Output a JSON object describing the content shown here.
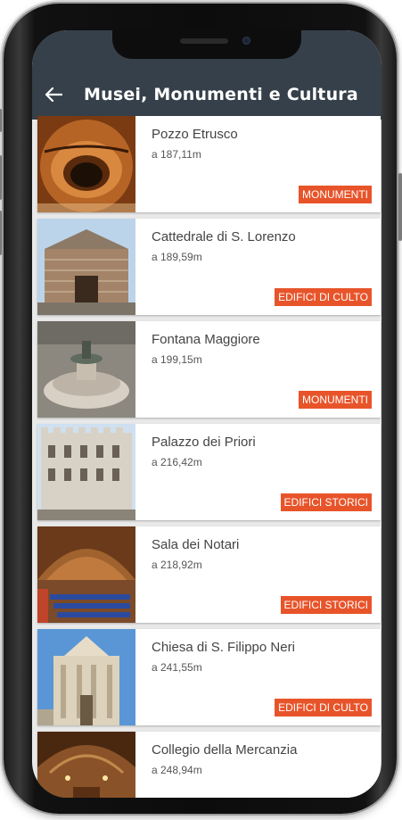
{
  "app_bar": {
    "back_icon": "arrow-left-icon",
    "title": "Musei, Monumenti e Cultura"
  },
  "places": [
    {
      "name": "Pozzo Etrusco",
      "distance": "a 187,11m",
      "category": "MONUMENTI",
      "thumb": "etruscan-well-photo"
    },
    {
      "name": "Cattedrale di S. Lorenzo",
      "distance": "a 189,59m",
      "category": "EDIFICI DI CULTO",
      "thumb": "cathedral-photo"
    },
    {
      "name": "Fontana Maggiore",
      "distance": "a 199,15m",
      "category": "MONUMENTI",
      "thumb": "fountain-photo"
    },
    {
      "name": "Palazzo dei Priori",
      "distance": "a 216,42m",
      "category": "EDIFICI STORICI",
      "thumb": "palace-photo"
    },
    {
      "name": "Sala dei Notari",
      "distance": "a 218,92m",
      "category": "EDIFICI STORICI",
      "thumb": "hall-photo"
    },
    {
      "name": "Chiesa di S. Filippo Neri",
      "distance": "a 241,55m",
      "category": "EDIFICI DI CULTO",
      "thumb": "church-photo"
    },
    {
      "name": "Collegio della Mercanzia",
      "distance": "a 248,94m",
      "category": "",
      "thumb": "collegio-photo"
    }
  ],
  "colors": {
    "app_bar": "#36404a",
    "category_tag": "#e8542a",
    "background": "#e9e9e9"
  }
}
